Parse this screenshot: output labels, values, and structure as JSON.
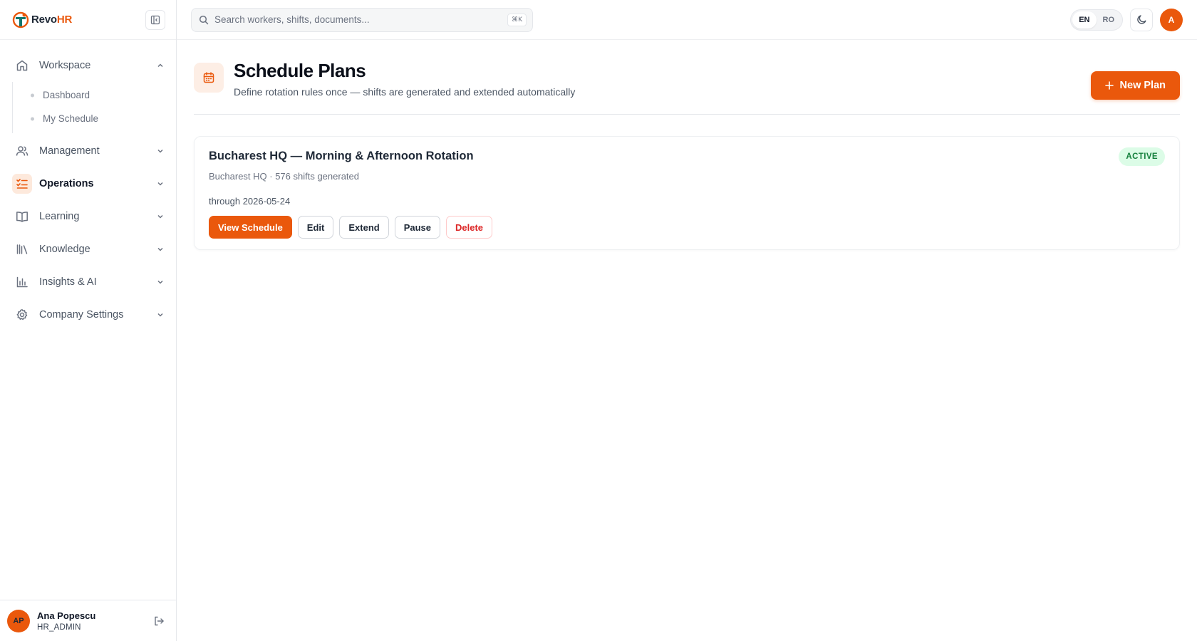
{
  "brand": {
    "name_part1": "Revo",
    "name_part2": "HR"
  },
  "search": {
    "placeholder": "Search workers, shifts, documents...",
    "shortcut": "⌘K"
  },
  "language": {
    "options": [
      "EN",
      "RO"
    ],
    "selected": "EN"
  },
  "top_user": {
    "initial": "A"
  },
  "sidebar": {
    "items": [
      {
        "label": "Workspace",
        "icon": "home-icon",
        "expanded": true,
        "children": [
          {
            "label": "Dashboard"
          },
          {
            "label": "My Schedule"
          }
        ]
      },
      {
        "label": "Management",
        "icon": "users-icon"
      },
      {
        "label": "Operations",
        "icon": "checklist-icon",
        "active": true
      },
      {
        "label": "Learning",
        "icon": "book-icon"
      },
      {
        "label": "Knowledge",
        "icon": "library-icon"
      },
      {
        "label": "Insights & AI",
        "icon": "bar-chart-icon"
      },
      {
        "label": "Company Settings",
        "icon": "gear-icon"
      }
    ]
  },
  "user": {
    "initials": "AP",
    "name": "Ana Popescu",
    "role": "HR_ADMIN"
  },
  "page": {
    "title": "Schedule Plans",
    "subtitle": "Define rotation rules once — shifts are generated and extended automatically",
    "new_button": "New Plan"
  },
  "plans": [
    {
      "name": "Bucharest HQ — Morning & Afternoon Rotation",
      "meta": "Bucharest HQ · 576 shifts generated",
      "through": "through 2026-05-24",
      "status": "ACTIVE",
      "actions": {
        "view": "View Schedule",
        "edit": "Edit",
        "extend": "Extend",
        "pause": "Pause",
        "delete": "Delete"
      }
    }
  ],
  "colors": {
    "accent": "#ea580c",
    "status_active_bg": "#dcfce7",
    "status_active_text": "#15803d",
    "danger": "#dc2626"
  }
}
